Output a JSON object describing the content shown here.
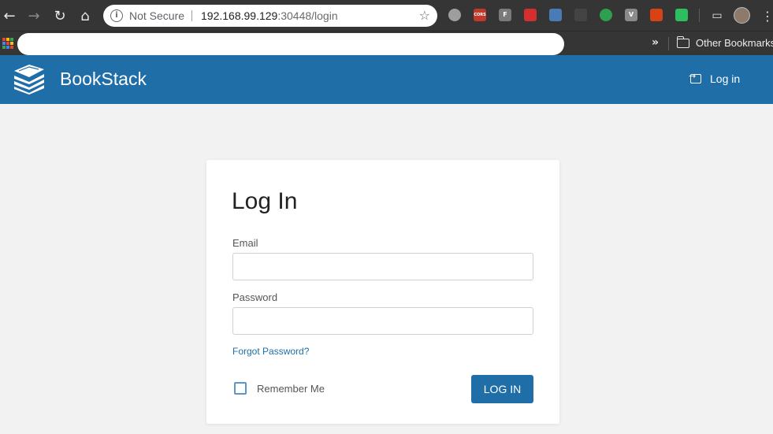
{
  "browser": {
    "security_label": "Not Secure",
    "url_host": "192.168.99.129",
    "url_rest": ":30448/login",
    "extensions": [
      {
        "name": "circle-extension",
        "color": "#9e9e9e",
        "text": ""
      },
      {
        "name": "cors-extension",
        "color": "#c0392b",
        "text": "CORS"
      },
      {
        "name": "f-extension",
        "color": "#7a7a7a",
        "text": "F"
      },
      {
        "name": "stop-extension",
        "color": "#d32f2f",
        "text": ""
      },
      {
        "name": "monitor-extension",
        "color": "#4a7bb7",
        "text": ""
      },
      {
        "name": "dark-extension",
        "color": "#444444",
        "text": ""
      },
      {
        "name": "green-dot-extension",
        "color": "#2e9e4f",
        "text": ""
      },
      {
        "name": "vue-extension",
        "color": "#8a8a8a",
        "text": "V"
      },
      {
        "name": "abp-extension",
        "color": "#d84315",
        "text": ""
      },
      {
        "name": "evernote-extension",
        "color": "#2dbe60",
        "text": ""
      }
    ],
    "other_bookmarks": "Other Bookmarks"
  },
  "app": {
    "brand": "BookStack",
    "header_login": "Log in"
  },
  "login_form": {
    "title": "Log In",
    "email_label": "Email",
    "email_value": "",
    "password_label": "Password",
    "password_value": "",
    "forgot_password": "Forgot Password?",
    "remember_me": "Remember Me",
    "remember_checked": false,
    "submit_label": "LOG IN"
  },
  "colors": {
    "brand_primary": "#206ea7",
    "page_background": "#f2f2f2"
  }
}
